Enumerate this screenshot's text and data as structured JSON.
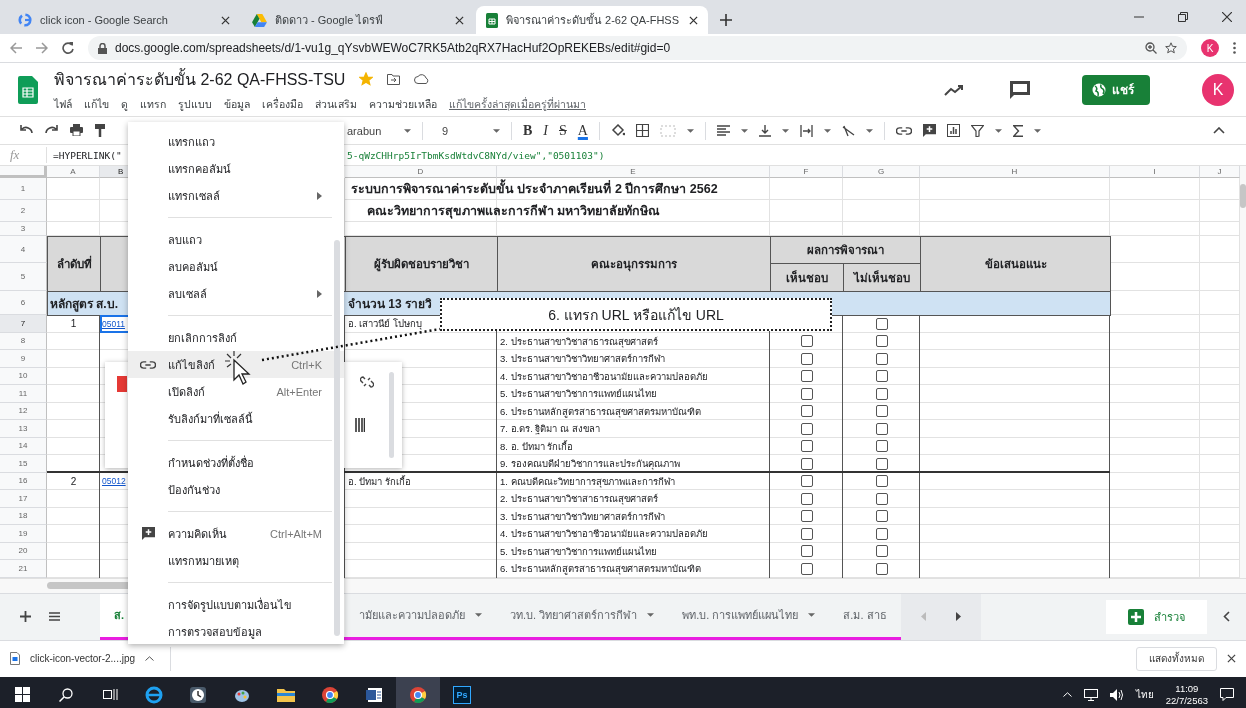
{
  "browser": {
    "tabs": [
      {
        "kind": "search",
        "title": "click icon - Google Search",
        "selected": false
      },
      {
        "kind": "drive",
        "title": "ติดดาว - Google ไดรฟ์",
        "selected": false
      },
      {
        "kind": "sheets",
        "title": "พิจารณาค่าระดับขั้น 2-62 QA-FHSS",
        "selected": true
      }
    ],
    "url": "docs.google.com/spreadsheets/d/1-vu1g_qYsvbWEWoC7RK5Atb2qRX7HacHuf2OpREKEBs/edit#gid=0",
    "profile": "K"
  },
  "document": {
    "title": "พิจารณาค่าระดับขั้น 2-62 QA-FHSS-TSU",
    "starred": true,
    "menus": [
      "ไฟล์",
      "แก้ไข",
      "ดู",
      "แทรก",
      "รูปแบบ",
      "ข้อมูล",
      "เครื่องมือ",
      "ส่วนเสริม",
      "ความช่วยเหลือ"
    ],
    "last_edit": "แก้ไขครั้งล่าสุดเมื่อครู่ที่ผ่านมา",
    "share": "แชร์",
    "avatar": "K"
  },
  "toolbar": {
    "font": "arabun",
    "size": "9",
    "format": [
      "B",
      "I",
      "S",
      "A"
    ]
  },
  "formula_bar": {
    "label": "fx",
    "formula_start": "=HYPERLINK(\"",
    "formula_end": "5-qWzCHHrp5IrTbmKsdWtdvC8NYd/view\",\"0501103\")"
  },
  "sheet": {
    "columns": [
      {
        "label": "A",
        "selected": false
      },
      {
        "label": "B",
        "selected": true
      },
      {
        "label": "D",
        "selected": false
      },
      {
        "label": "E",
        "selected": false
      },
      {
        "label": "F",
        "selected": false
      },
      {
        "label": "G",
        "selected": false
      },
      {
        "label": "H",
        "selected": false
      },
      {
        "label": "I",
        "selected": false
      },
      {
        "label": "J",
        "selected": false
      }
    ],
    "row_headers": [
      {
        "label": "1",
        "selected": false
      },
      {
        "label": "2",
        "selected": false
      },
      {
        "label": "3",
        "selected": false
      },
      {
        "label": "4",
        "selected": false
      },
      {
        "label": "5",
        "selected": false
      },
      {
        "label": "6",
        "selected": false
      },
      {
        "label": "7",
        "selected": true
      },
      {
        "label": "8",
        "selected": false
      },
      {
        "label": "9",
        "selected": false
      },
      {
        "label": "10",
        "selected": false
      },
      {
        "label": "11",
        "selected": false
      },
      {
        "label": "12",
        "selected": false
      },
      {
        "label": "13",
        "selected": false
      },
      {
        "label": "14",
        "selected": false
      },
      {
        "label": "15",
        "selected": false
      },
      {
        "label": "16",
        "selected": false
      },
      {
        "label": "17",
        "selected": false
      },
      {
        "label": "18",
        "selected": false
      },
      {
        "label": "19",
        "selected": false
      },
      {
        "label": "20",
        "selected": false
      },
      {
        "label": "21",
        "selected": false
      }
    ],
    "title": "ระบบการพิจารณาค่าระดับขั้น ประจำภาคเรียนที่ 2 ปีการศึกษา 2562",
    "subtitle": "คณะวิทยาการสุขภาพและการกีฬา มหาวิทยาลัยทักษิณ",
    "header": {
      "order": "ลำดับที่",
      "responsible": "ผู้รับผิดชอบรายวิชา",
      "committee": "คณะอนุกรรมการ",
      "result": "ผลการพิจารณา",
      "approve": "เห็นชอบ",
      "disapprove": "ไม่เห็นชอบ",
      "suggestion": "ข้อเสนอแนะ"
    },
    "section": {
      "program": "หลักสูตร ส.บ.",
      "count": "จำนวน 13 รายวิ"
    },
    "rows": [
      {
        "order": "1",
        "course": {
          "text": "05011",
          "selected": true
        },
        "responsible": "อ. เสาวนีย์ โปษกบุ",
        "disapprove_checked": false
      },
      {
        "committee": "2. ประธานสาขาวิชาสาธารณสุขศาสตร์",
        "approve_checked": false,
        "disapprove_checked": false
      },
      {
        "committee": "3. ประธานสาขาวิชาวิทยาศาสตร์การกีฬา",
        "approve_checked": false,
        "disapprove_checked": false
      },
      {
        "committee": "4. ประธานสาขาวิชาอาชีวอนามัยและความปลอดภัย",
        "approve_checked": false,
        "disapprove_checked": false
      },
      {
        "committee": "5. ประธานสาขาวิชาการแพทย์แผนไทย",
        "approve_checked": false,
        "disapprove_checked": false
      },
      {
        "committee": "6. ประธานหลักสูตรสาธารณสุขศาสตรมหาบัณฑิต",
        "approve_checked": false,
        "disapprove_checked": false
      },
      {
        "committee": "7. อ.ดร. ฐิติมา ณ สงขลา",
        "approve_checked": false,
        "disapprove_checked": false
      },
      {
        "committee": "8. อ. ปัทมา รักเกื้อ",
        "approve_checked": false,
        "disapprove_checked": false
      },
      {
        "committee": "9. รองคณบดีฝ่ายวิชาการและประกันคุณภาพ",
        "approve_checked": false,
        "disapprove_checked": false
      },
      {
        "order": "2",
        "course": {
          "text": "05012",
          "selected": false
        },
        "responsible": "อ. ปัทมา รักเกื้อ",
        "committee": "1. คณบดีคณะวิทยาการสุขภาพและการกีฬา",
        "approve_checked": false,
        "disapprove_checked": false
      },
      {
        "committee": "2. ประธานสาขาวิชาสาธารณสุขศาสตร์",
        "approve_checked": false,
        "disapprove_checked": false
      },
      {
        "committee": "3. ประธานสาขาวิชาวิทยาศาสตร์การกีฬา",
        "approve_checked": false,
        "disapprove_checked": false
      },
      {
        "committee": "4. ประธานสาขาวิชาอาชีวอนามัยและความปลอดภัย",
        "approve_checked": false,
        "disapprove_checked": false
      },
      {
        "committee": "5. ประธานสาขาวิชาการแพทย์แผนไทย",
        "approve_checked": false,
        "disapprove_checked": false
      },
      {
        "committee": "6. ประธานหลักสูตรสาธารณสุขศาสตรมหาบัณฑิต",
        "approve_checked": false,
        "disapprove_checked": false
      }
    ]
  },
  "menu": {
    "items": [
      {
        "kind": "item",
        "label": "แทรกแถว",
        "selected": false
      },
      {
        "kind": "item",
        "label": "แทรกคอลัมน์",
        "selected": false
      },
      {
        "kind": "item",
        "label": "แทรกเซลล์",
        "submenu": true,
        "selected": false
      },
      {
        "kind": "divider"
      },
      {
        "kind": "item",
        "label": "ลบแถว",
        "selected": false
      },
      {
        "kind": "item",
        "label": "ลบคอลัมน์",
        "selected": false
      },
      {
        "kind": "item",
        "label": "ลบเซลล์",
        "submenu": true,
        "selected": false
      },
      {
        "kind": "divider"
      },
      {
        "kind": "item",
        "label": "ยกเลิกการลิงก์",
        "selected": false
      },
      {
        "kind": "link-item",
        "label": "แก้ไขลิงก์",
        "shortcut": "Ctrl+K",
        "selected": true
      },
      {
        "kind": "item",
        "label": "เปิดลิงก์",
        "shortcut": "Alt+Enter",
        "selected": false
      },
      {
        "kind": "item",
        "label": "รับลิงก์มาที่เซลล์นี้",
        "selected": false
      },
      {
        "kind": "divider"
      },
      {
        "kind": "item",
        "label": "กำหนดช่วงที่ตั้งชื่อ",
        "selected": false
      },
      {
        "kind": "item",
        "label": "ป้องกันช่วง",
        "selected": false
      },
      {
        "kind": "divider"
      },
      {
        "kind": "comment-item",
        "label": "ความคิดเห็น",
        "shortcut": "Ctrl+Alt+M",
        "selected": false
      },
      {
        "kind": "item",
        "label": "แทรกหมายเหตุ",
        "selected": false
      },
      {
        "kind": "divider"
      },
      {
        "kind": "item",
        "label": "การจัดรูปแบบตามเงื่อนไข",
        "selected": false
      },
      {
        "kind": "item",
        "label": "การตรวจสอบข้อมูล",
        "selected": false
      }
    ]
  },
  "callout": {
    "text": "6. แทรก URL หรือแก้ไข URL"
  },
  "sheet_tabs": {
    "tabs": [
      {
        "label": "ส.",
        "selected": true,
        "dropdown": false
      },
      {
        "label": "ามัยและความปลอดภัย",
        "selected": false,
        "dropdown": true
      },
      {
        "label": "วท.บ. วิทยาศาสตร์การกีฬา",
        "selected": false,
        "dropdown": true
      },
      {
        "label": "พท.บ. การแพทย์แผนไทย",
        "selected": false,
        "dropdown": true
      },
      {
        "label": "ส.ม. สาธ",
        "selected": false,
        "dropdown": false
      }
    ],
    "explore": "สำรวจ"
  },
  "download_bar": {
    "file": "click-icon-vector-2....jpg",
    "show_all": "แสดงทั้งหมด"
  },
  "taskbar": {
    "apps": [
      {
        "kind": "browser-e",
        "selected": false
      },
      {
        "kind": "clock",
        "selected": false
      },
      {
        "kind": "paint",
        "selected": false
      },
      {
        "kind": "folder",
        "selected": false
      },
      {
        "kind": "chrome",
        "selected": false
      },
      {
        "kind": "word",
        "selected": false
      },
      {
        "kind": "chrome",
        "selected": true
      },
      {
        "kind": "photoshop",
        "label": "Ps",
        "selected": false
      }
    ],
    "language": "ไทย",
    "time": "11:09",
    "date": "22/7/2563"
  }
}
